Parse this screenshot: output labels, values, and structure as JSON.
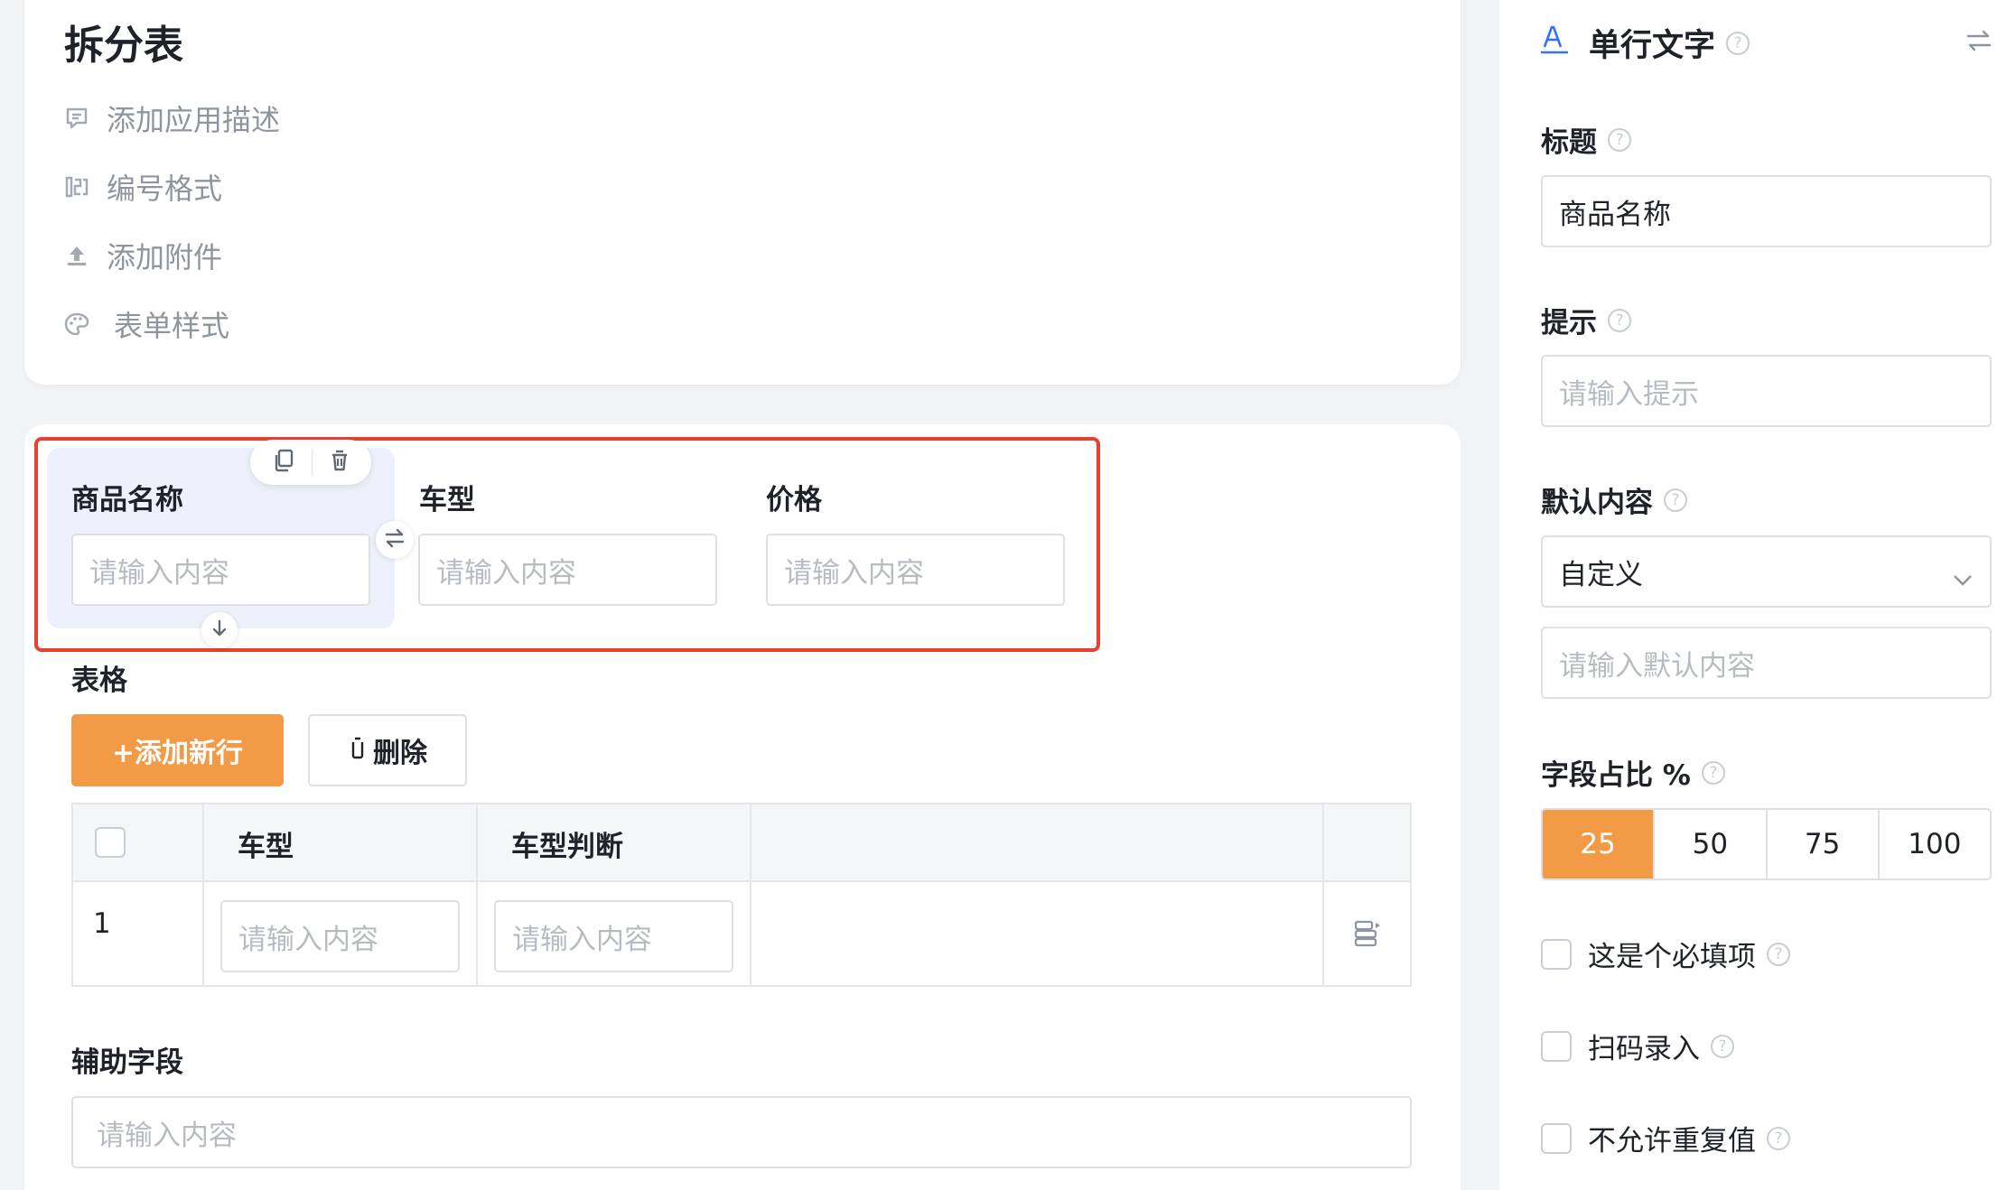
{
  "form": {
    "title": "拆分表",
    "menu": [
      {
        "icon": "comment-icon",
        "label": "添加应用描述"
      },
      {
        "icon": "numbering-icon",
        "label": "编号格式"
      },
      {
        "icon": "upload-icon",
        "label": "添加附件"
      },
      {
        "icon": "palette-icon",
        "label": "表单样式"
      }
    ]
  },
  "canvas": {
    "fields": [
      {
        "label": "商品名称",
        "placeholder": "请输入内容"
      },
      {
        "label": "车型",
        "placeholder": "请输入内容"
      },
      {
        "label": "价格",
        "placeholder": "请输入内容"
      }
    ],
    "table_section": {
      "label": "表格",
      "add_button": "+添加新行",
      "delete_button": "删除",
      "columns": [
        "车型",
        "车型判断"
      ],
      "rows": [
        {
          "index": "1",
          "cells": [
            "请输入内容",
            "请输入内容"
          ]
        }
      ]
    },
    "aux_field": {
      "label": "辅助字段",
      "placeholder": "请输入内容"
    }
  },
  "panel": {
    "field_type": "单行文字",
    "title_label": "标题",
    "title_value": "商品名称",
    "hint_label": "提示",
    "hint_placeholder": "请输入提示",
    "default_label": "默认内容",
    "default_select": "自定义",
    "default_placeholder": "请输入默认内容",
    "ratio_label": "字段占比 %",
    "ratio_options": [
      "25",
      "50",
      "75",
      "100"
    ],
    "ratio_selected": "25",
    "checks": [
      "这是个必填项",
      "扫码录入",
      "不允许重复值"
    ],
    "help_glyph": "?"
  },
  "colors": {
    "accent": "#f29a45",
    "selection_frame": "#e5432f",
    "selected_field_bg": "#eef0fc"
  }
}
